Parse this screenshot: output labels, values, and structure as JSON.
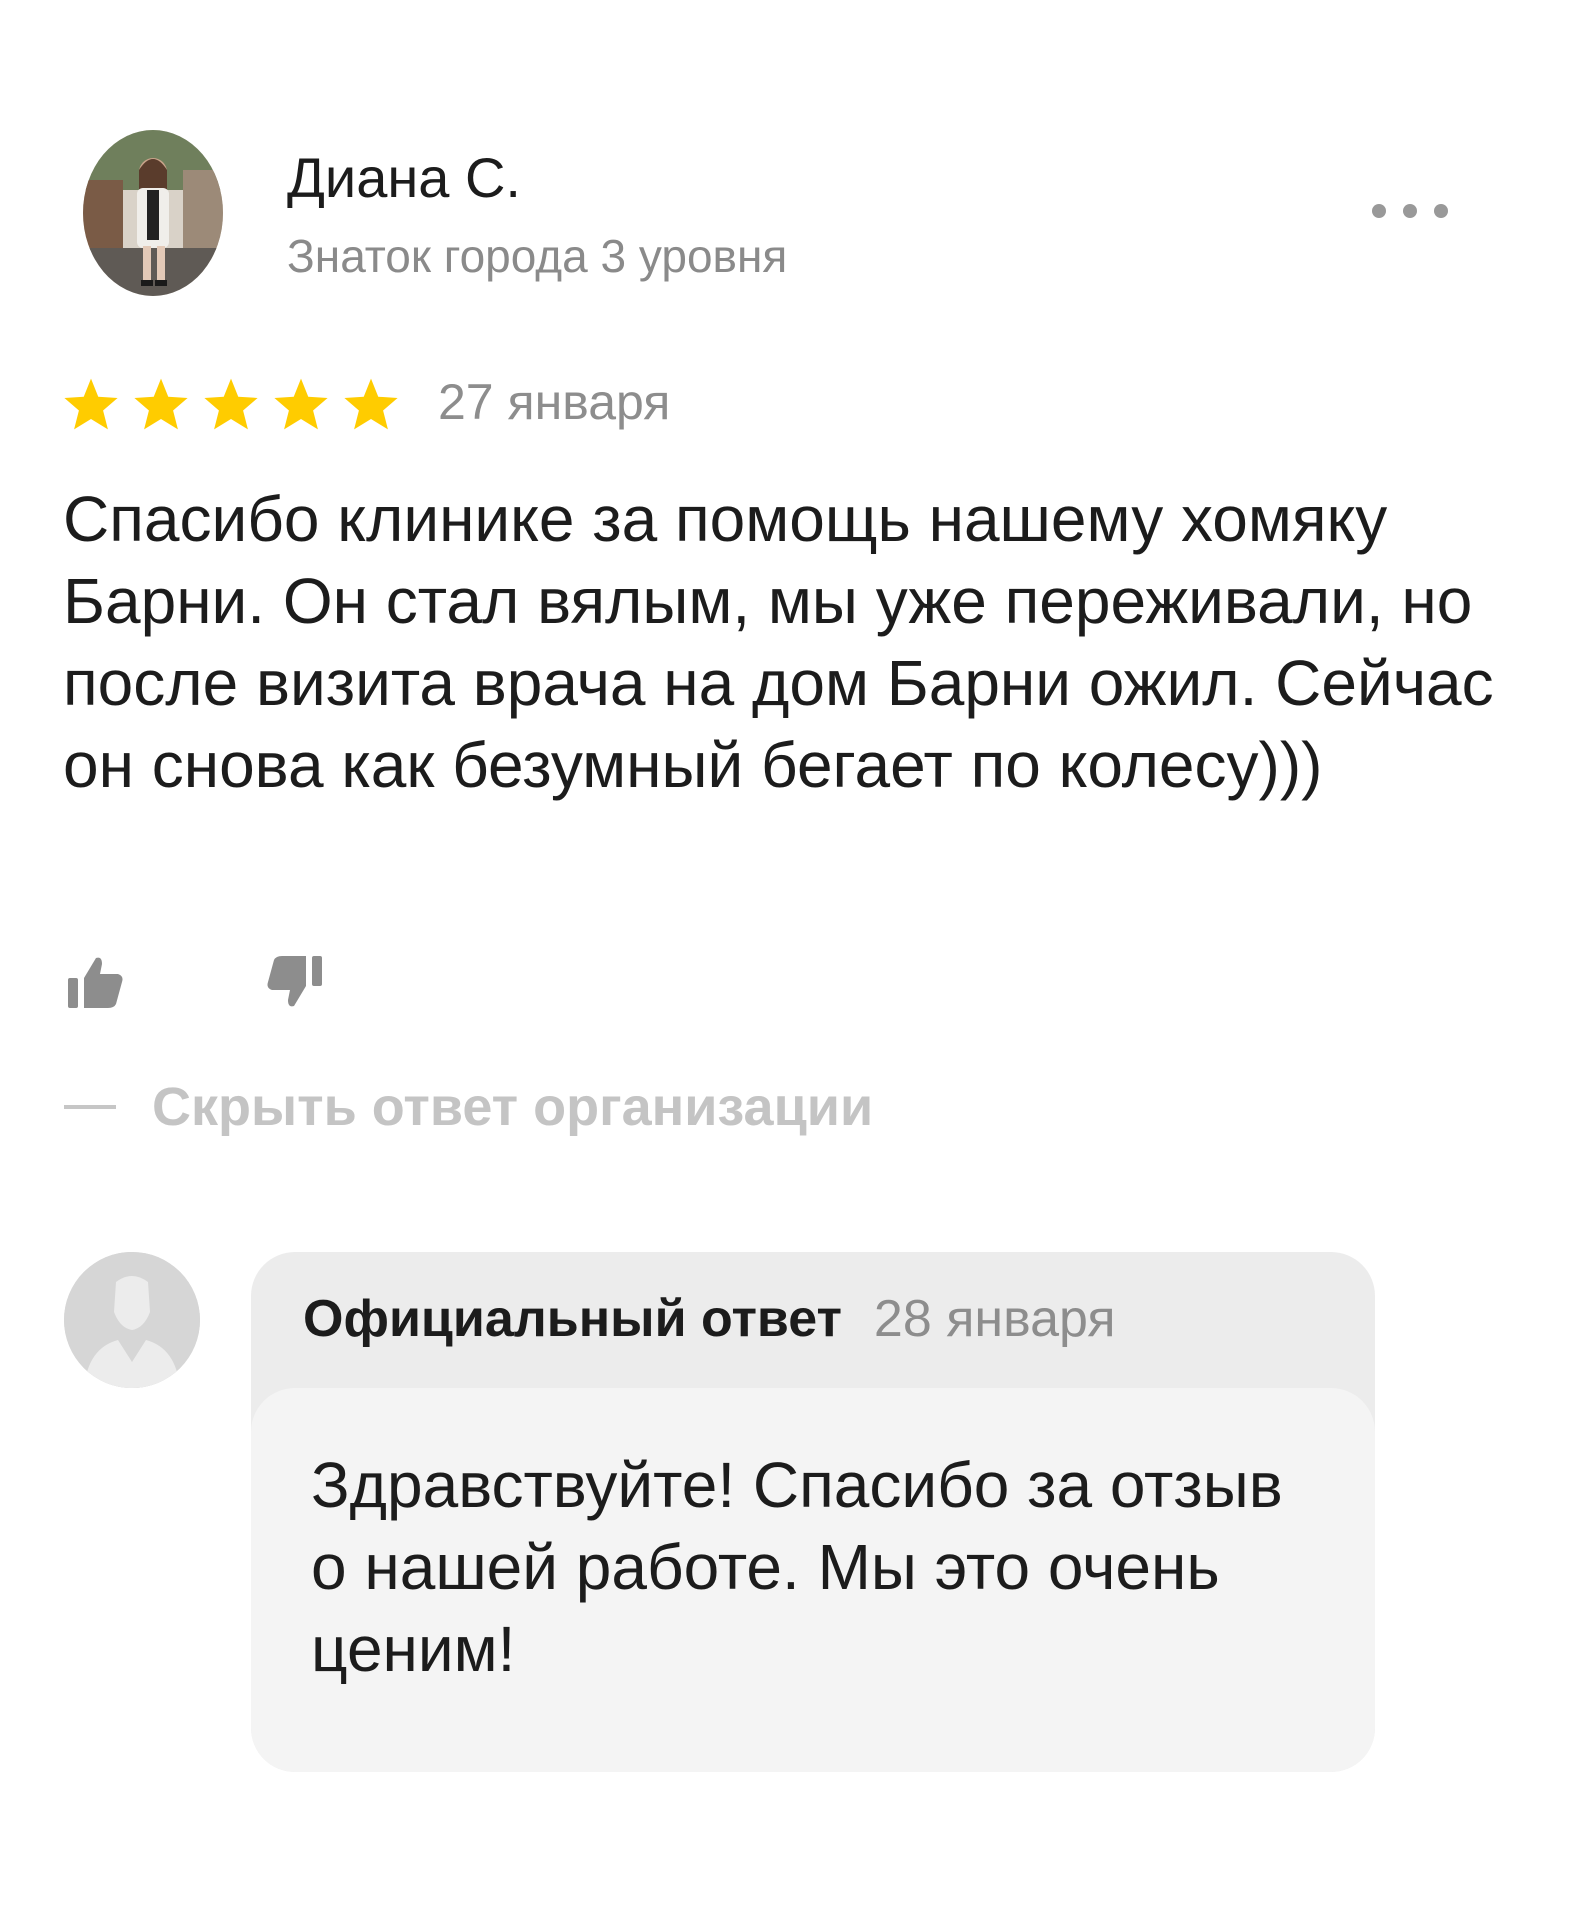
{
  "review": {
    "author_name": "Диана С.",
    "author_level": "Знаток города 3 уровня",
    "rating": 5,
    "rating_max": 5,
    "date": "27 января",
    "text": "Спасибо клинике за помощь нашему хомяку Барни. Он стал вялым, мы уже переживали, но после визита врача на дом Барни ожил. Сейчас он снова как безумный бегает по колесу)))",
    "more_icon": "more-dots-icon",
    "like_icon": "thumbs-up-icon",
    "dislike_icon": "thumbs-down-icon",
    "hide_answer_label": "Скрыть ответ организации"
  },
  "reply": {
    "title": "Официальный ответ",
    "date": "28 января",
    "text": "Здравствуйте! Спасибо за отзыв о нашей работе. Мы это очень ценим!",
    "avatar_icon": "organization-avatar-icon"
  },
  "colors": {
    "star": "#FFCC00",
    "muted_text": "#8D8D8D",
    "reply_header_bg": "#ECECEC",
    "reply_body_bg": "#F4F4F4"
  }
}
